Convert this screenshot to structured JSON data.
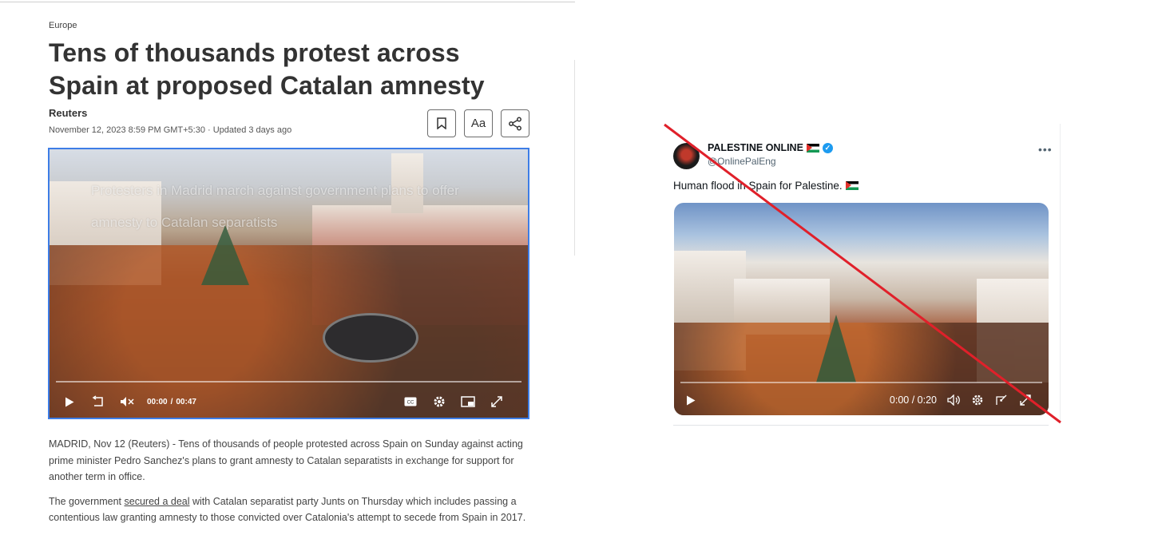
{
  "article": {
    "kicker": "Europe",
    "headline": "Tens of thousands protest across Spain at proposed Catalan amnesty",
    "byline": "Reuters",
    "dateline": "November 12, 2023 8:59 PM GMT+5:30 · Updated 3 days ago",
    "toolbar": {
      "bookmark_icon": "bookmark-icon",
      "text_size_label": "Aa",
      "share_icon": "share-icon"
    },
    "video": {
      "caption": "Protesters in Madrid march against government plans to offer amnesty to Catalan separatists",
      "current_time": "00:00",
      "separator": "/",
      "duration": "00:47",
      "cc_label": "CC"
    },
    "paragraph1": "MADRID, Nov 12 (Reuters) - Tens of thousands of people protested across Spain on Sunday against acting prime minister Pedro Sanchez's plans to grant amnesty to Catalan separatists in exchange for support for another term in office.",
    "paragraph2_before": "The government ",
    "paragraph2_link": "secured a deal",
    "paragraph2_after": " with Catalan separatist party Junts on Thursday which includes passing a contentious law granting amnesty to those convicted over Catalonia's attempt to secede from Spain in 2017."
  },
  "tweet": {
    "display_name": "PALESTINE ONLINE",
    "handle": "@OnlinePalEng",
    "more_label": "•••",
    "text": "Human flood in Spain for Palestine.",
    "video": {
      "time": "0:00 / 0:20"
    }
  },
  "colors": {
    "video_border": "#3d7de6",
    "verified_blue": "#1d9bf0",
    "cross_line": "#e0202a"
  }
}
